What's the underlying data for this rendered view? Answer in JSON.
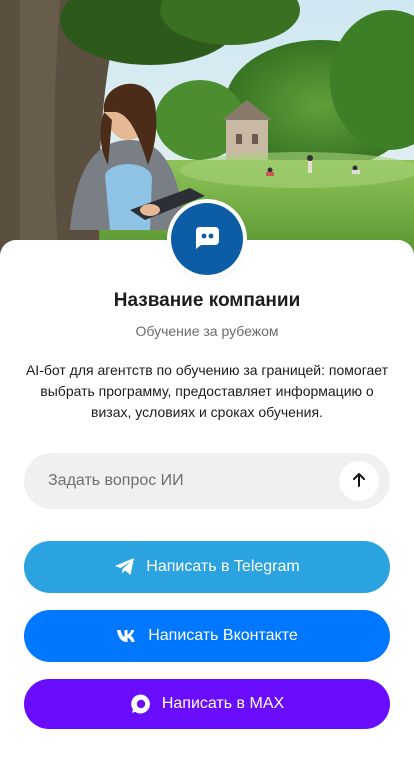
{
  "company": {
    "name": "Название компании",
    "subtitle": "Обучение за рубежом",
    "description": "AI-бот для агентств по обучению за границей: помогает выбрать программу, предоставляет информацию о визах, условиях и сроках обучения.",
    "avatar_icon": "chat-bot-icon"
  },
  "ask": {
    "placeholder": "Задать вопрос ИИ",
    "value": "",
    "send_icon": "arrow-up-icon"
  },
  "buttons": {
    "telegram": {
      "label": "Написать в Telegram",
      "icon": "telegram-icon",
      "color": "#2aa3e0"
    },
    "vk": {
      "label": "Написать Вконтакте",
      "icon": "vk-icon",
      "color": "#0077ff"
    },
    "max": {
      "label": "Написать в MAX",
      "icon": "max-icon",
      "color": "#6a0dff"
    }
  },
  "colors": {
    "avatar": "#0d5da6",
    "input_bg": "#f0f0f2",
    "text": "#1c1c1e",
    "muted": "#6b6b70"
  }
}
